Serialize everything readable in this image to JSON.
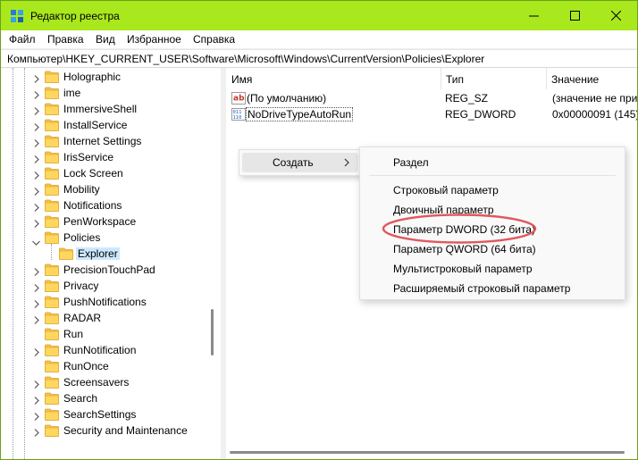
{
  "window": {
    "title": "Редактор реестра",
    "accent_color": "#a9e81d",
    "icon": "registry-editor-icon",
    "controls": [
      "minimize-icon",
      "maximize-icon",
      "close-icon"
    ]
  },
  "menu": [
    "Файл",
    "Правка",
    "Вид",
    "Избранное",
    "Справка"
  ],
  "address": "Компьютер\\HKEY_CURRENT_USER\\Software\\Microsoft\\Windows\\CurrentVersion\\Policies\\Explorer",
  "tree": {
    "items": [
      {
        "label": "Holographic",
        "expander": "collapsed"
      },
      {
        "label": "ime",
        "expander": "collapsed"
      },
      {
        "label": "ImmersiveShell",
        "expander": "collapsed"
      },
      {
        "label": "InstallService",
        "expander": "collapsed"
      },
      {
        "label": "Internet Settings",
        "expander": "collapsed"
      },
      {
        "label": "IrisService",
        "expander": "collapsed"
      },
      {
        "label": "Lock Screen",
        "expander": "collapsed"
      },
      {
        "label": "Mobility",
        "expander": "collapsed"
      },
      {
        "label": "Notifications",
        "expander": "collapsed"
      },
      {
        "label": "PenWorkspace",
        "expander": "collapsed"
      },
      {
        "label": "Policies",
        "expander": "expanded"
      },
      {
        "label": "Explorer",
        "expander": "none",
        "selected": true,
        "child": true
      },
      {
        "label": "PrecisionTouchPad",
        "expander": "collapsed"
      },
      {
        "label": "Privacy",
        "expander": "collapsed"
      },
      {
        "label": "PushNotifications",
        "expander": "collapsed"
      },
      {
        "label": "RADAR",
        "expander": "collapsed"
      },
      {
        "label": "Run",
        "expander": "none"
      },
      {
        "label": "RunNotification",
        "expander": "collapsed"
      },
      {
        "label": "RunOnce",
        "expander": "none"
      },
      {
        "label": "Screensavers",
        "expander": "collapsed"
      },
      {
        "label": "Search",
        "expander": "collapsed"
      },
      {
        "label": "SearchSettings",
        "expander": "collapsed"
      },
      {
        "label": "Security and Maintenance",
        "expander": "collapsed"
      }
    ]
  },
  "list": {
    "columns": [
      "Имя",
      "Тип",
      "Значение"
    ],
    "rows": [
      {
        "name": "(По умолчанию)",
        "type": "REG_SZ",
        "value": "(значение не при",
        "icon": "string-value-icon"
      },
      {
        "name": "NoDriveTypeAutoRun",
        "type": "REG_DWORD",
        "value": "0x00000091 (145)",
        "icon": "binary-value-icon"
      }
    ]
  },
  "context_menu": {
    "label": "Создать"
  },
  "submenu": {
    "first": "Раздел",
    "items": [
      "Строковый параметр",
      "Двоичный параметр",
      "Параметр DWORD (32 бита)",
      "Параметр QWORD (64 бита)",
      "Мультистроковый параметр",
      "Расширяемый строковый параметр"
    ],
    "highlighted_index": 2,
    "highlight_color": "#e0585e"
  }
}
